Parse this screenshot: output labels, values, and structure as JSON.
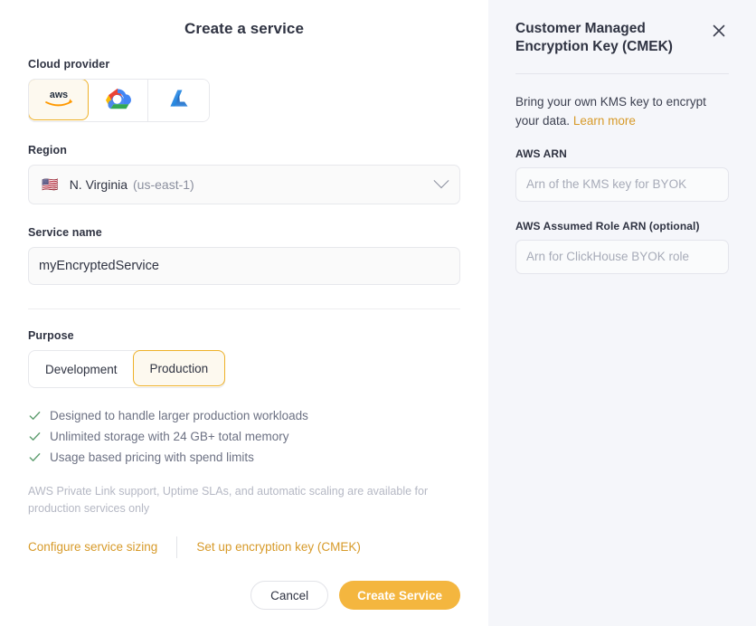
{
  "form": {
    "title": "Create a service",
    "cloud_provider": {
      "label": "Cloud provider",
      "options": [
        {
          "id": "aws",
          "icon": "aws-logo-icon",
          "selected": true
        },
        {
          "id": "gcp",
          "icon": "google-cloud-logo-icon",
          "selected": false
        },
        {
          "id": "azure",
          "icon": "azure-logo-icon",
          "selected": false
        }
      ]
    },
    "region": {
      "label": "Region",
      "flag": "🇺🇸",
      "name": "N. Virginia",
      "code": "(us-east-1)"
    },
    "service_name": {
      "label": "Service name",
      "value": "myEncryptedService"
    },
    "purpose": {
      "label": "Purpose",
      "development_label": "Development",
      "production_label": "Production",
      "selected": "Production"
    },
    "features": [
      "Designed to handle larger production workloads",
      "Unlimited storage with 24 GB+ total memory",
      "Usage based pricing with spend limits"
    ],
    "note": "AWS Private Link support, Uptime SLAs, and automatic scaling are available for production services only",
    "links": {
      "configure_sizing": "Configure service sizing",
      "setup_cmek": "Set up encryption key (CMEK)"
    },
    "footer": {
      "cancel_label": "Cancel",
      "create_label": "Create Service"
    }
  },
  "cmek_panel": {
    "title": "Customer Managed Encryption Key (CMEK)",
    "close_icon": "close-icon",
    "description_prefix": "Bring your own KMS key to encrypt your data.",
    "learn_more": "Learn more",
    "aws_arn": {
      "label": "AWS ARN",
      "value": "",
      "placeholder": "Arn of the KMS key for BYOK"
    },
    "assumed_role_arn": {
      "label": "AWS Assumed Role ARN (optional)",
      "value": "",
      "placeholder": "Arn for ClickHouse BYOK role"
    }
  },
  "colors": {
    "accent": "#f4b63f",
    "link": "#d79a29",
    "selected_tile_bg": "#fdf9ef",
    "selected_tile_border": "#eeb128",
    "panel_bg": "#f5f6fa",
    "check_green": "#5f9e70",
    "text_primary": "#2f3342",
    "text_muted": "#6c7183"
  }
}
